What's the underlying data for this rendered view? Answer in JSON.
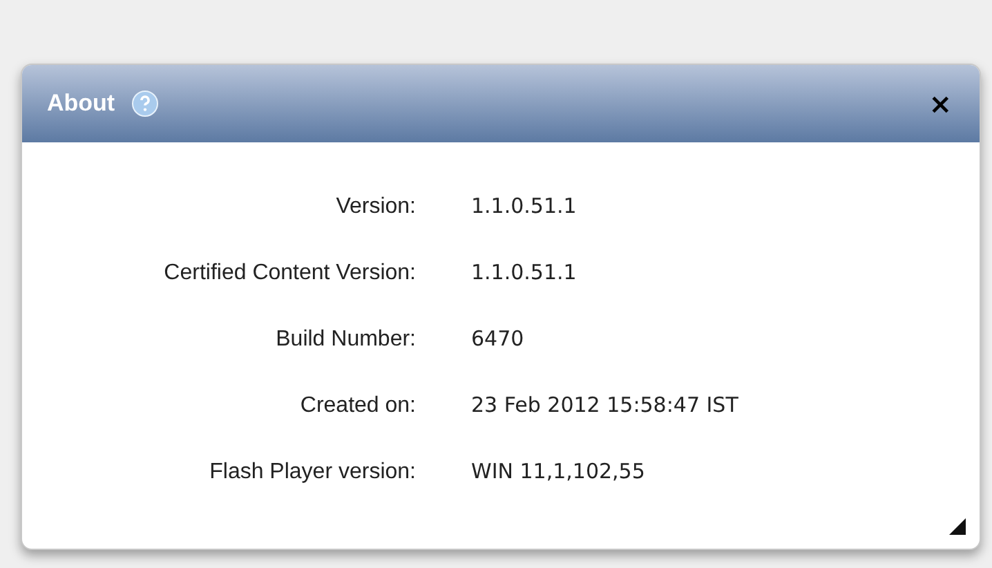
{
  "dialog": {
    "title": "About",
    "close": "×",
    "rows": [
      {
        "label": "Version:",
        "value": "1.1.0.51.1"
      },
      {
        "label": "Certified Content Version:",
        "value": "1.1.0.51.1"
      },
      {
        "label": "Build Number:",
        "value": "6470"
      },
      {
        "label": "Created on:",
        "value": "23 Feb 2012 15:58:47 IST"
      },
      {
        "label": "Flash Player version:",
        "value": "WIN 11,1,102,55"
      }
    ]
  }
}
